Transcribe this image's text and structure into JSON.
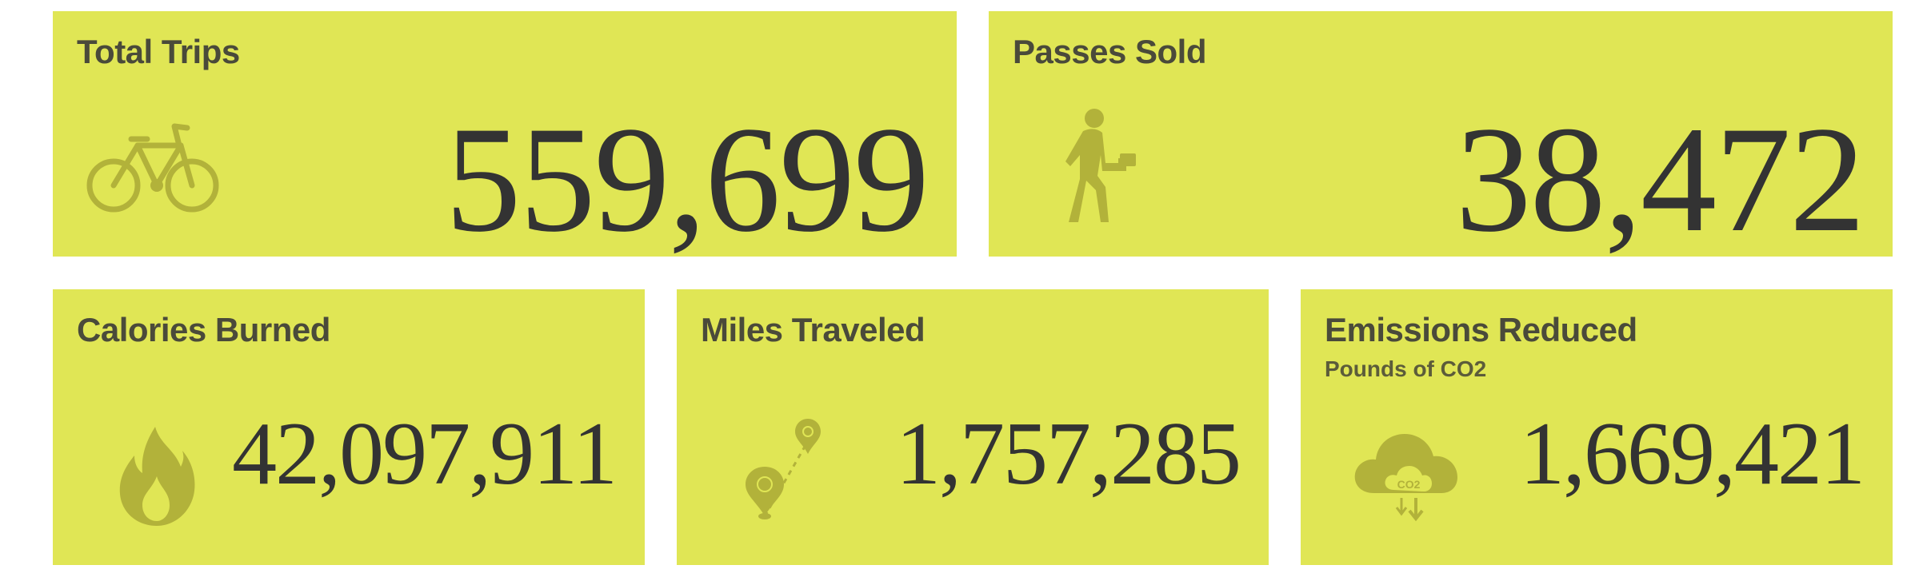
{
  "theme": {
    "card_bg": "#e0e655",
    "icon_color": "#b2b23a",
    "title_color": "#4a4a3a",
    "value_color": "#333333"
  },
  "cards": {
    "trips": {
      "title": "Total Trips",
      "value": "559,699",
      "icon": "bicycle-icon"
    },
    "passes": {
      "title": "Passes Sold",
      "value": "38,472",
      "icon": "walking-person-icon"
    },
    "calories": {
      "title": "Calories Burned",
      "value": "42,097,911",
      "icon": "flame-icon"
    },
    "miles": {
      "title": "Miles Traveled",
      "value": "1,757,285",
      "icon": "map-route-icon"
    },
    "emissions": {
      "title": "Emissions Reduced",
      "subtitle": "Pounds of CO2",
      "value": "1,669,421",
      "icon": "co2-cloud-icon",
      "icon_label": "CO2"
    }
  }
}
